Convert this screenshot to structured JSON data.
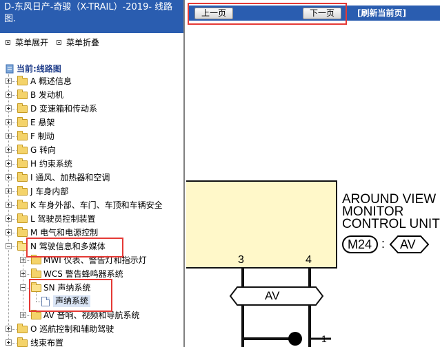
{
  "left_panel": {
    "title": "D-东风日产-奇骏（X-TRAIL）-2019- 线路图.",
    "menu_expand": "菜单展开",
    "menu_collapse": "菜单折叠",
    "current_label": "当前:线路图",
    "tree": [
      {
        "label": "A 概述信息"
      },
      {
        "label": "B 发动机"
      },
      {
        "label": "D 变速箱和传动系"
      },
      {
        "label": "E 悬架"
      },
      {
        "label": "F 制动"
      },
      {
        "label": "G 转向"
      },
      {
        "label": "H 约束系统"
      },
      {
        "label": "I 通风、加热器和空调"
      },
      {
        "label": "J 车身内部"
      },
      {
        "label": "K 车身外部、车门、车顶和车辆安全"
      },
      {
        "label": "L 驾驶员控制装置"
      },
      {
        "label": "M 电气和电源控制"
      },
      {
        "label": "N 驾驶信息和多媒体"
      },
      {
        "label": "MWI 仪表、警告灯和指示灯"
      },
      {
        "label": "WCS 警告蜂鸣器系统"
      },
      {
        "label": "SN 声纳系统"
      },
      {
        "label": "声纳系统"
      },
      {
        "label": "AV 音响、视频和导航系统"
      },
      {
        "label": "O 巡航控制和辅助驾驶"
      },
      {
        "label": "线束布置"
      }
    ]
  },
  "right_panel": {
    "prev_page": "上一页",
    "next_page": "下一页",
    "refresh": "[刷新当前页]"
  },
  "diagram": {
    "module_lines": [
      "AROUND VIEW",
      "MONITOR",
      "CONTROL UNIT"
    ],
    "connector": "M24",
    "colon": ":",
    "connector_tag": "AV",
    "pin_left": "3",
    "pin_right": "4",
    "bus_label": "AV",
    "ground_pin": "1"
  },
  "colors": {
    "title_bg": "#2a5db0",
    "highlight": "#e53935",
    "module_fill": "#fff8c9"
  }
}
